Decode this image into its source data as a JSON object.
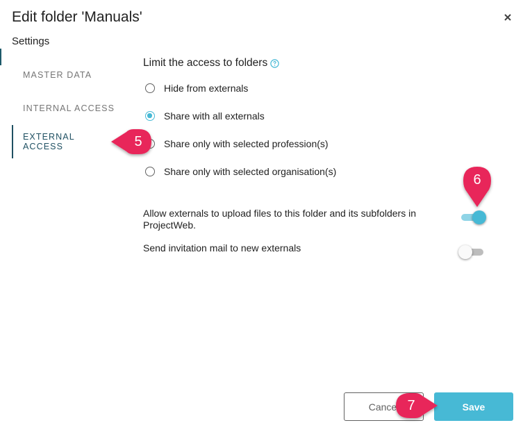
{
  "dialog": {
    "title": "Edit folder 'Manuals'",
    "subtitle": "Settings"
  },
  "nav": {
    "items": [
      {
        "label": "MASTER DATA"
      },
      {
        "label": "INTERNAL ACCESS"
      },
      {
        "label": "EXTERNAL ACCESS",
        "active": true
      }
    ]
  },
  "section": {
    "heading": "Limit the access to folders",
    "options": [
      {
        "label": "Hide from externals",
        "checked": false
      },
      {
        "label": "Share with all externals",
        "checked": true
      },
      {
        "label": "Share only with selected profession(s)",
        "checked": false
      },
      {
        "label": "Share only with selected organisation(s)",
        "checked": false
      }
    ]
  },
  "settings": {
    "upload_label": "Allow externals to upload files to this folder and its subfolders in ProjectWeb.",
    "upload_enabled": true,
    "invite_label": "Send invitation mail to new externals",
    "invite_enabled": false
  },
  "footer": {
    "cancel_label": "Cancel",
    "save_label": "Save"
  },
  "callouts": [
    "5",
    "6",
    "7"
  ],
  "colors": {
    "accent": "#47b9d5",
    "nav_active": "#1f5062",
    "callout": "#e8285a"
  }
}
